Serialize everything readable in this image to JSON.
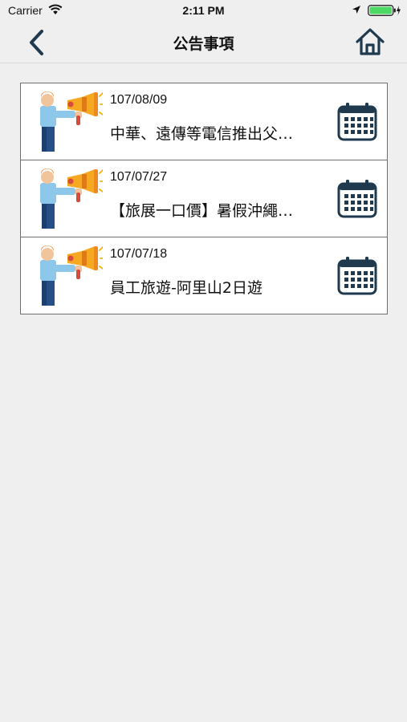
{
  "status_bar": {
    "carrier": "Carrier",
    "time": "2:11 PM"
  },
  "nav": {
    "title": "公告事項",
    "back_icon": "chevron-left-icon",
    "home_icon": "home-icon"
  },
  "announcements": [
    {
      "date": "107/08/09",
      "title": "中華、遠傳等電信推出父…"
    },
    {
      "date": "107/07/27",
      "title": "【旅展一口價】暑假沖繩…"
    },
    {
      "date": "107/07/18",
      "title": "員工旅遊-阿里山2日遊"
    }
  ],
  "colors": {
    "accent": "#1f3a4f",
    "background": "#efefef",
    "card": "#ffffff",
    "battery": "#4cd964"
  }
}
